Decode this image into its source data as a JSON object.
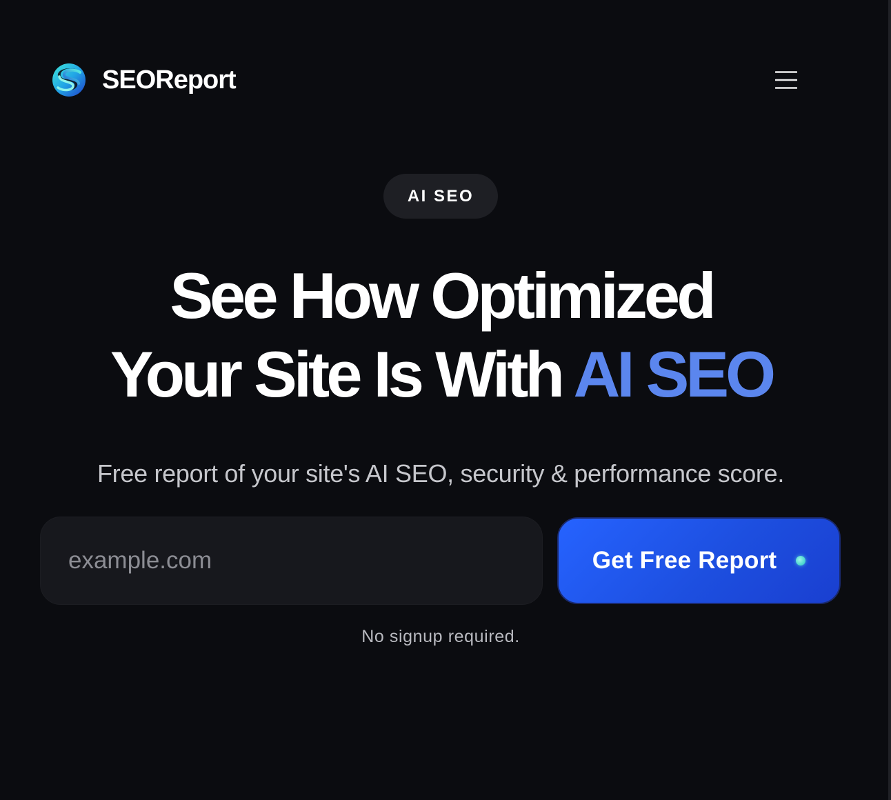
{
  "brand": {
    "name": "SEOReport",
    "logo_icon": "swirl-s-logo-icon"
  },
  "header": {
    "menu_icon": "hamburger-menu-icon"
  },
  "hero": {
    "badge": "AI SEO",
    "title_line1": "See How Optimized",
    "title_line2_prefix": "Your Site Is With ",
    "title_line2_accent": "AI SEO",
    "subtitle": "Free report of your site's AI SEO, security & performance score."
  },
  "form": {
    "input_placeholder": "example.com",
    "input_value": "",
    "submit_label": "Get Free Report",
    "submit_status_icon": "status-dot-icon",
    "note": "No signup required."
  },
  "colors": {
    "background": "#0b0c10",
    "accent_text": "#5b86ee",
    "button": "#1d4fe0",
    "input_background": "#17181d",
    "badge_background": "#1e1f24"
  }
}
